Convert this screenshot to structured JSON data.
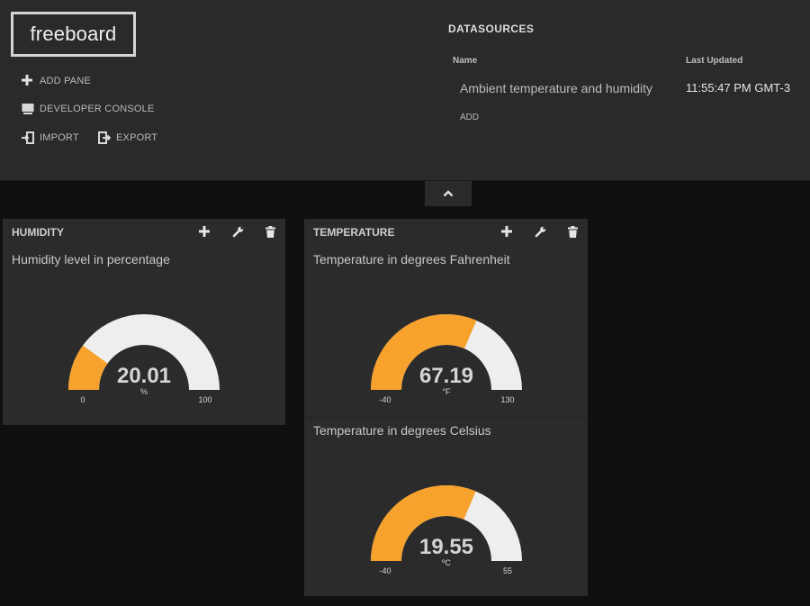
{
  "header": {
    "logo": "freeboard",
    "menu": {
      "add_pane": "ADD PANE",
      "developer_console": "DEVELOPER CONSOLE",
      "import": "IMPORT",
      "export": "EXPORT"
    },
    "datasources": {
      "title": "DATASOURCES",
      "col_name": "Name",
      "col_last_updated": "Last Updated",
      "rows": [
        {
          "name": "Ambient temperature and humidity",
          "last_updated": "11:55:47 PM GMT-3"
        }
      ],
      "add_label": "ADD"
    }
  },
  "panes": {
    "humidity": {
      "title": "HUMIDITY",
      "widgets": [
        {
          "title": "Humidity level in percentage",
          "value": "20.01",
          "units": "%",
          "min": "0",
          "max": "100"
        }
      ]
    },
    "temperature": {
      "title": "TEMPERATURE",
      "widgets": [
        {
          "title": "Temperature in degrees Fahrenheit",
          "value": "67.19",
          "units": "°F",
          "min": "-40",
          "max": "130"
        },
        {
          "title": "Temperature in degrees Celsius",
          "value": "19.55",
          "units": "ºC",
          "min": "-40",
          "max": "55"
        }
      ]
    }
  },
  "icons": {
    "add_pane": "plus-icon",
    "developer_console": "monitor-icon",
    "import": "import-icon",
    "export": "export-icon",
    "toggle": "chevron-up-icon",
    "pane_tools": [
      "plus-icon",
      "wrench-icon",
      "trash-icon"
    ]
  },
  "colors": {
    "gauge_fill": "#f7a22d",
    "gauge_track": "#eeeeee",
    "pane_bg": "#2b2b2b",
    "header_bg": "#2a2a2a",
    "page_bg": "#101012"
  }
}
